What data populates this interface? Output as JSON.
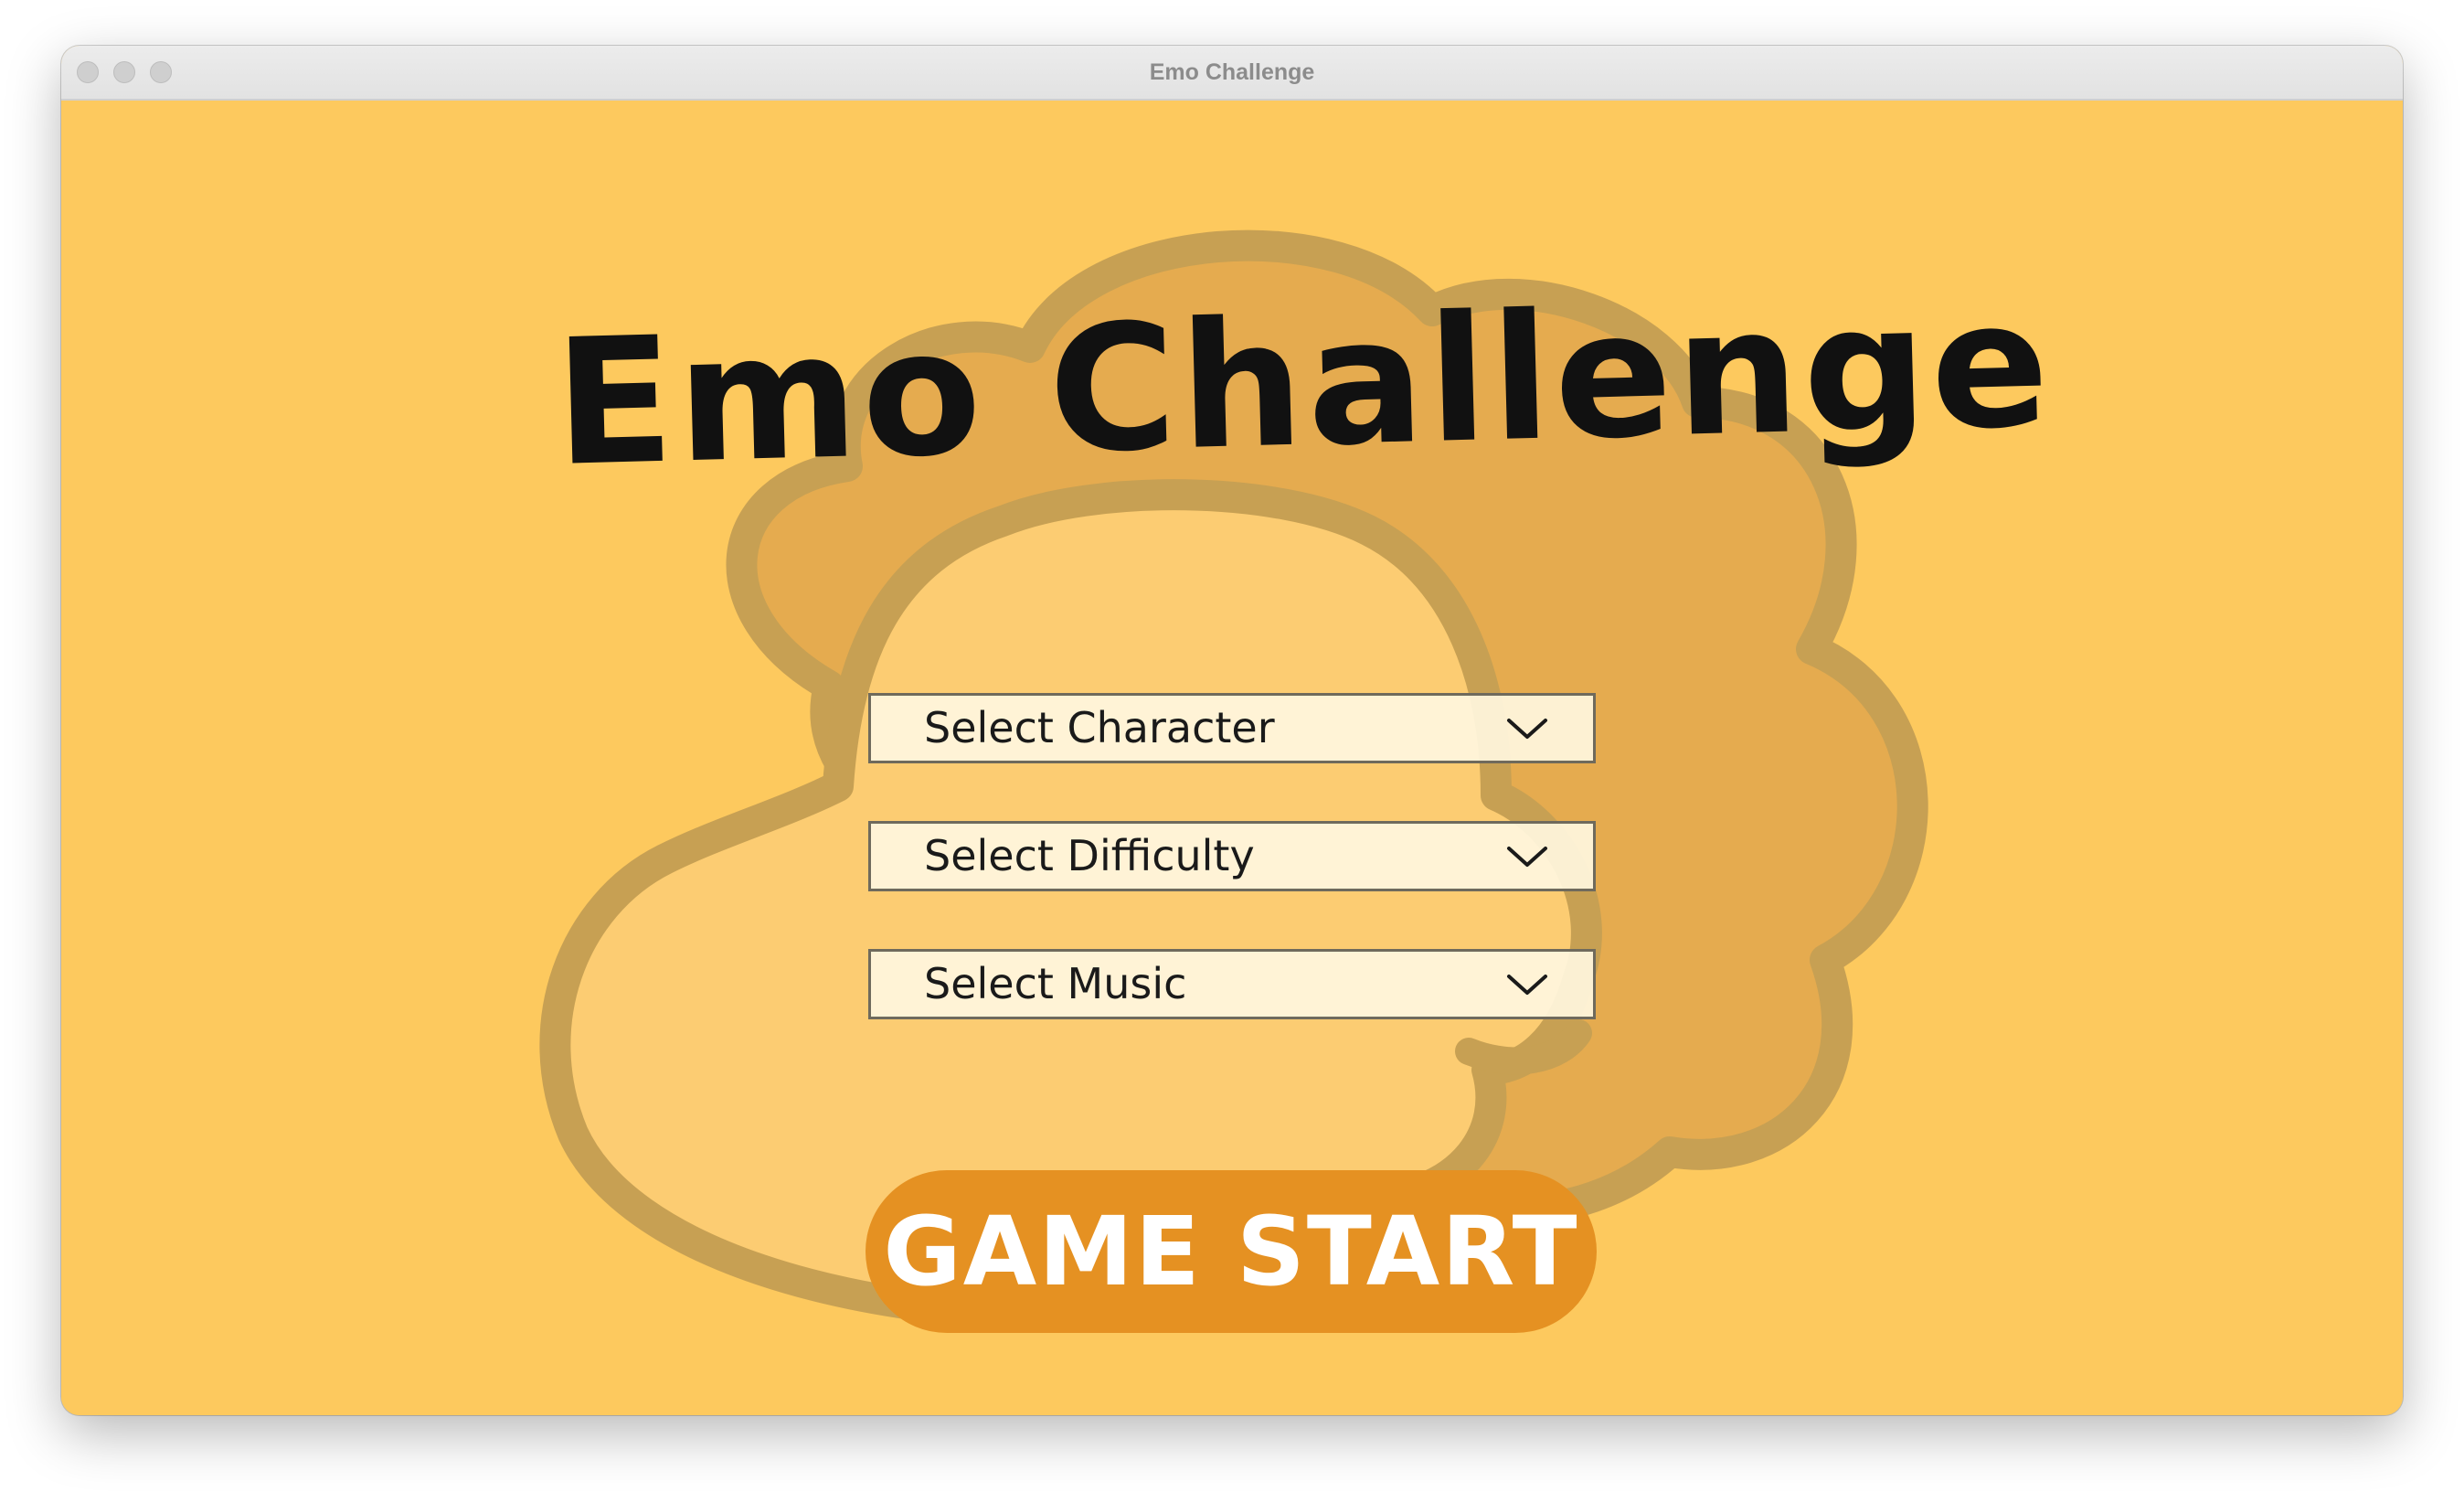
{
  "window": {
    "title": "Emo Challenge"
  },
  "game": {
    "title": "Emo Challenge"
  },
  "selects": {
    "character": {
      "label": "Select Character",
      "icon": "chevron-down-icon"
    },
    "difficulty": {
      "label": "Select Difficulty",
      "icon": "chevron-down-icon"
    },
    "music": {
      "label": "Select Music",
      "icon": "chevron-down-icon"
    }
  },
  "start_button": {
    "label": "GAME START"
  },
  "colors": {
    "background": "#fdc95e",
    "blob_back": "#e5ab4f",
    "blob_front": "#fccc72",
    "blob_outline": "#c7a053",
    "button": "#e59122",
    "button_text": "#ffffff",
    "select_fill": "#fff6de",
    "title_text": "#111111"
  }
}
